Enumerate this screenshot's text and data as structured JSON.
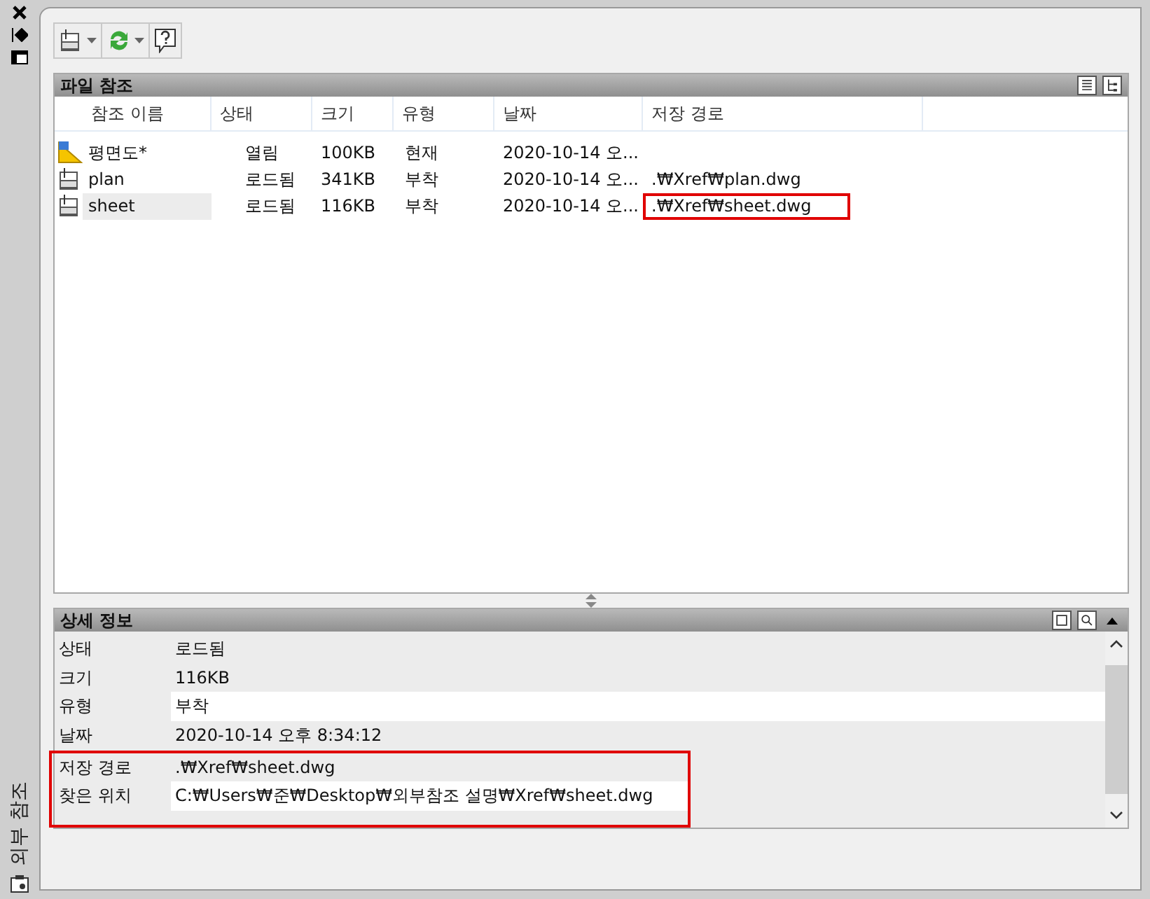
{
  "side_label": "외부 참조",
  "file_refs": {
    "title": "파일 참조",
    "columns": [
      "참조 이름",
      "상태",
      "크기",
      "유형",
      "날짜",
      "저장 경로"
    ],
    "rows": [
      {
        "kind": "drawing",
        "name": "평면도*",
        "status": "열림",
        "size": "100KB",
        "type": "현재",
        "date": "2020-10-14 오...",
        "path": "",
        "selected": false,
        "highlighted": false
      },
      {
        "kind": "dwg",
        "name": "plan",
        "status": "로드됨",
        "size": "341KB",
        "type": "부착",
        "date": "2020-10-14 오...",
        "path": ".₩Xref₩plan.dwg",
        "selected": false,
        "highlighted": false
      },
      {
        "kind": "dwg",
        "name": "sheet",
        "status": "로드됨",
        "size": "116KB",
        "type": "부착",
        "date": "2020-10-14 오...",
        "path": ".₩Xref₩sheet.dwg",
        "selected": true,
        "highlighted": true
      }
    ]
  },
  "details": {
    "title": "상세 정보",
    "rows": [
      {
        "label": "상태",
        "value": "로드됨",
        "highlighted": false
      },
      {
        "label": "크기",
        "value": "116KB",
        "highlighted": false
      },
      {
        "label": "유형",
        "value": "부착",
        "highlighted": false
      },
      {
        "label": "날짜",
        "value": "2020-10-14 오후 8:34:12",
        "highlighted": false
      },
      {
        "label": "저장 경로",
        "value": ".₩Xref₩sheet.dwg",
        "highlighted": true
      },
      {
        "label": "찾은 위치",
        "value": "C:₩Users₩준₩Desktop₩외부참조 설명₩Xref₩sheet.dwg",
        "highlighted": true
      }
    ]
  }
}
